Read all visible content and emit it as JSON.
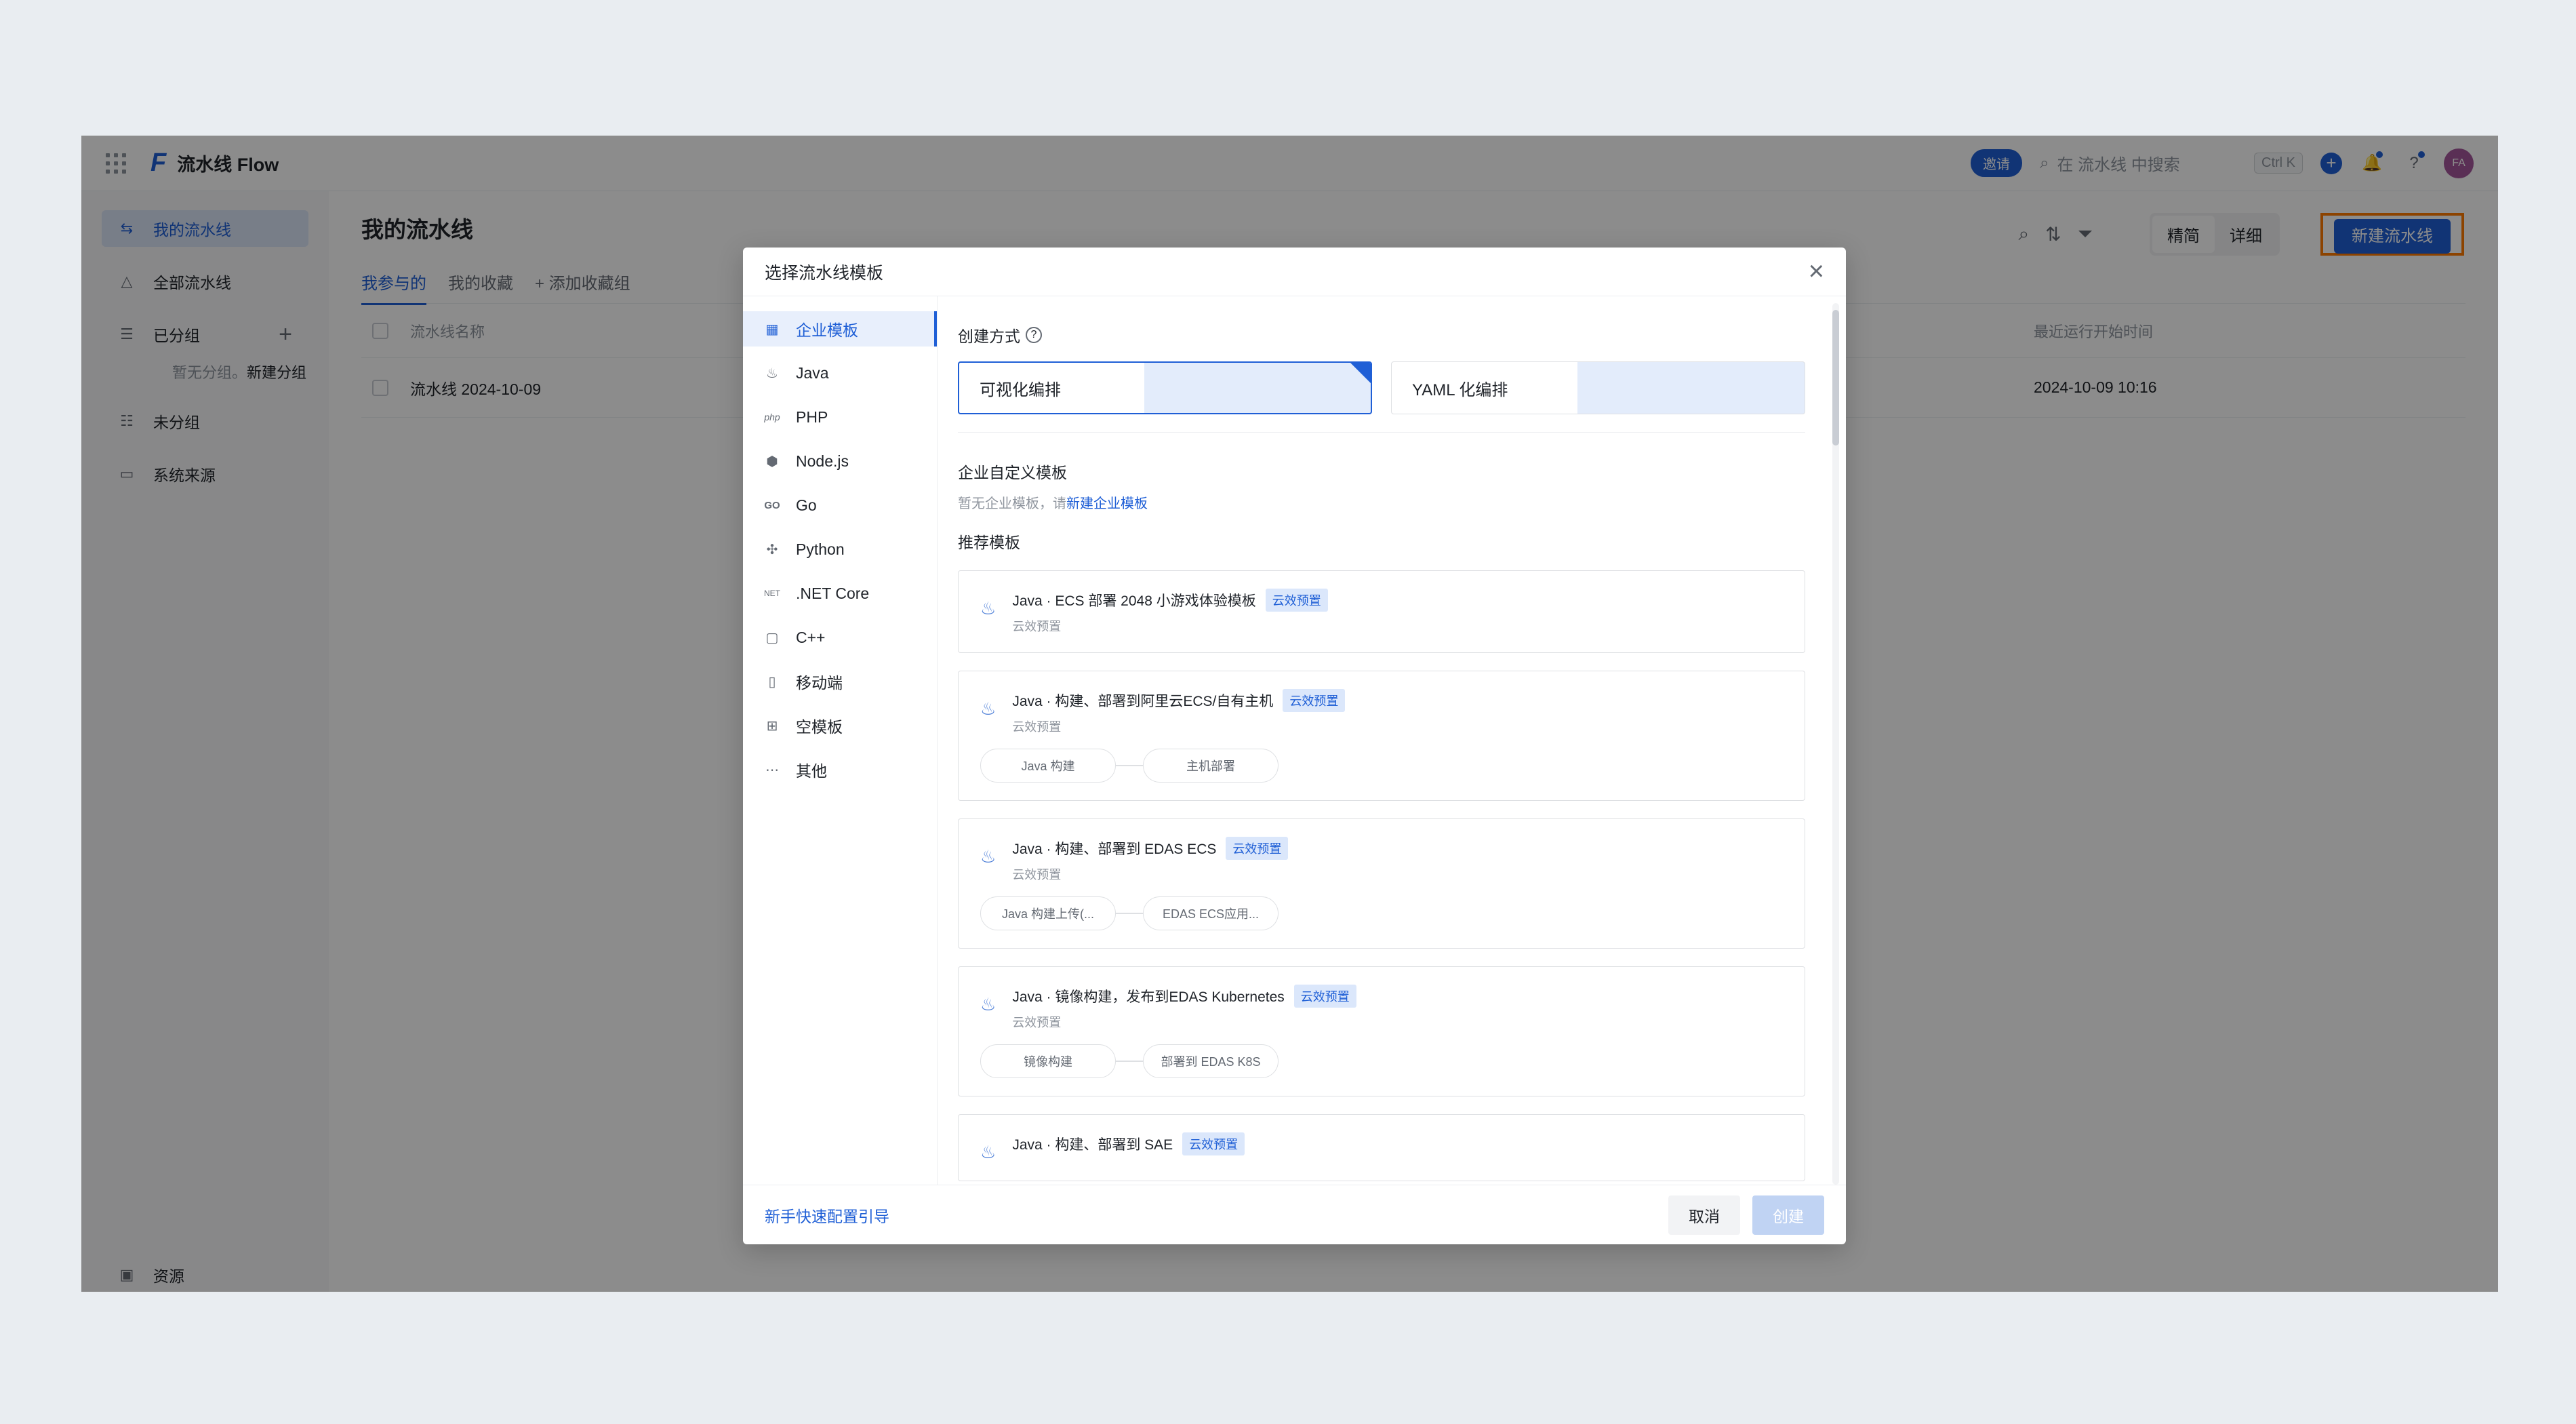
{
  "app": {
    "title": "流水线 Flow",
    "logo": "F"
  },
  "topbar": {
    "invite": "邀请",
    "search_placeholder": "在 流水线 中搜索",
    "shortcut": "Ctrl K",
    "avatar": "FA"
  },
  "sidebar": {
    "items": [
      {
        "label": "我的流水线"
      },
      {
        "label": "全部流水线"
      },
      {
        "label": "已分组"
      },
      {
        "label": "未分组"
      },
      {
        "label": "系统来源"
      }
    ],
    "empty_group_text": "暂无分组。",
    "new_group_link": "新建分组",
    "bottom_item": "资源"
  },
  "main": {
    "title": "我的流水线",
    "tabs": [
      "我参与的",
      "我的收藏",
      "添加收藏组"
    ],
    "view_simple": "精简",
    "view_detail": "详细",
    "new_button": "新建流水线",
    "columns": {
      "name": "流水线名称",
      "last_run": "最近运行开始时间"
    },
    "rows": [
      {
        "name": "流水线 2024-10-09",
        "last_run": "2024-10-09 10:16"
      }
    ]
  },
  "modal": {
    "title": "选择流水线模板",
    "nav": [
      {
        "label": "企业模板",
        "icon": "grid-icon"
      },
      {
        "label": "Java",
        "icon": "java-icon"
      },
      {
        "label": "PHP",
        "icon": "php-icon"
      },
      {
        "label": "Node.js",
        "icon": "nodejs-icon"
      },
      {
        "label": "Go",
        "icon": "go-icon"
      },
      {
        "label": "Python",
        "icon": "python-icon"
      },
      {
        "label": ".NET Core",
        "icon": "dotnet-icon"
      },
      {
        "label": "C++",
        "icon": "cpp-icon"
      },
      {
        "label": "移动端",
        "icon": "mobile-icon"
      },
      {
        "label": "空模板",
        "icon": "blank-template-icon"
      },
      {
        "label": "其他",
        "icon": "more-icon"
      }
    ],
    "creation_method_label": "创建方式",
    "method_visual": "可视化编排",
    "method_yaml": "YAML 化编排",
    "enterprise_custom_title": "企业自定义模板",
    "enterprise_hint": "暂无企业模板，请",
    "enterprise_link": "新建企业模板",
    "recommended_title": "推荐模板",
    "templates": [
      {
        "name": "Java · ECS 部署 2048 小游戏体验模板",
        "tag": "云效预置",
        "sub": "云效预置",
        "steps": []
      },
      {
        "name": "Java · 构建、部署到阿里云ECS/自有主机",
        "tag": "云效预置",
        "sub": "云效预置",
        "steps": [
          "Java 构建",
          "主机部署"
        ]
      },
      {
        "name": "Java · 构建、部署到 EDAS ECS",
        "tag": "云效预置",
        "sub": "云效预置",
        "steps": [
          "Java 构建上传(...",
          "EDAS ECS应用..."
        ]
      },
      {
        "name": "Java · 镜像构建，发布到EDAS Kubernetes",
        "tag": "云效预置",
        "sub": "云效预置",
        "steps": [
          "镜像构建",
          "部署到 EDAS K8S"
        ]
      },
      {
        "name": "Java · 构建、部署到 SAE",
        "tag": "云效预置",
        "sub": "",
        "steps": []
      }
    ],
    "guide_link": "新手快速配置引导",
    "cancel": "取消",
    "create": "创建"
  }
}
